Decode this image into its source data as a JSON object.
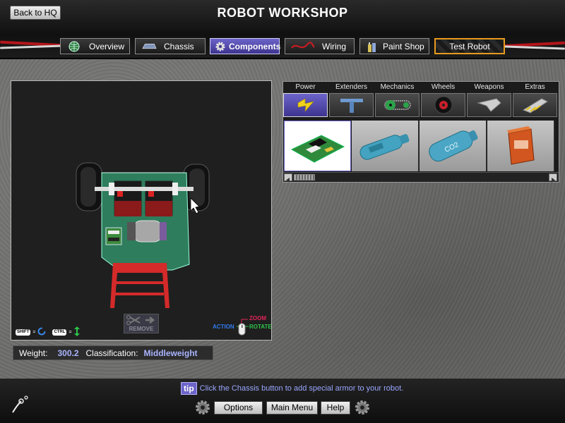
{
  "header": {
    "back_label": "Back to HQ",
    "title": "ROBOT WORKSHOP"
  },
  "tabs": [
    {
      "label": "Overview",
      "icon": "globe-icon"
    },
    {
      "label": "Chassis",
      "icon": "chassis-icon"
    },
    {
      "label": "Components",
      "icon": "gear-icon",
      "active": true
    },
    {
      "label": "Wiring",
      "icon": "wire-icon"
    },
    {
      "label": "Paint Shop",
      "icon": "paint-icon"
    },
    {
      "label": "Test Robot",
      "icon": "",
      "style": "hazard"
    }
  ],
  "viewport": {
    "remove_label": "REMOVE",
    "shift_key": "SHIFT",
    "ctrl_key": "CTRL",
    "equals": "=",
    "mouse_action": "ACTION",
    "mouse_zoom": "ZOOM",
    "mouse_rotate": "ROTATE"
  },
  "stats": {
    "weight_label": "Weight:",
    "weight_value": "300.2",
    "class_label": "Classification:",
    "class_value": "Middleweight"
  },
  "categories": [
    {
      "label": "Power",
      "icon": "lightning-icon",
      "active": true
    },
    {
      "label": "Extenders",
      "icon": "extender-icon"
    },
    {
      "label": "Mechanics",
      "icon": "chain-gear-icon"
    },
    {
      "label": "Wheels",
      "icon": "wheel-icon"
    },
    {
      "label": "Weapons",
      "icon": "blade-icon"
    },
    {
      "label": "Extras",
      "icon": "wedge-icon"
    }
  ],
  "parts": [
    {
      "icon": "circuit-board-icon",
      "selected": true
    },
    {
      "icon": "gas-tank-icon"
    },
    {
      "icon": "co2-tank-icon"
    },
    {
      "icon": "battery-icon"
    }
  ],
  "tip": {
    "badge": "tip",
    "text": "Click the Chassis button to add special armor to your robot."
  },
  "footer": {
    "options_label": "Options",
    "main_menu_label": "Main Menu",
    "help_label": "Help"
  },
  "colors": {
    "accent": "#6c64c9",
    "hazard": "#e89a1c",
    "cable_red": "#b3161b",
    "value_text": "#a9b4ff"
  }
}
